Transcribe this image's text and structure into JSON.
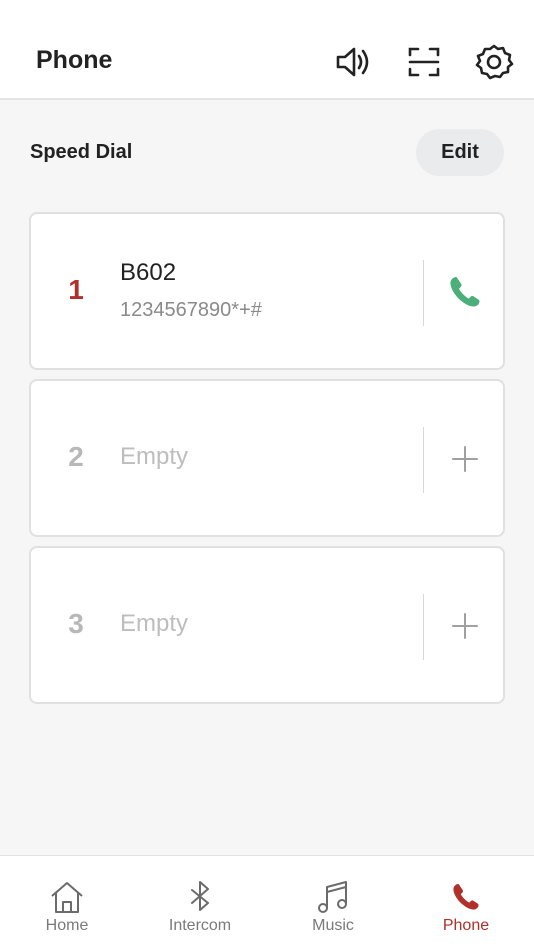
{
  "header": {
    "title": "Phone",
    "icons": [
      "speaker-icon",
      "scan-icon",
      "gear-icon"
    ]
  },
  "speed_dial": {
    "title": "Speed Dial",
    "edit_label": "Edit",
    "entries": [
      {
        "index": "1",
        "name": "B602",
        "number": "1234567890*+#",
        "action": "phone-icon"
      },
      {
        "index": "2",
        "placeholder": "Empty",
        "action": "plus-icon"
      },
      {
        "index": "3",
        "placeholder": "Empty",
        "action": "plus-icon"
      }
    ]
  },
  "tabbar": {
    "tabs": [
      {
        "label": "Home",
        "icon": "home-icon"
      },
      {
        "label": "Intercom",
        "icon": "bluetooth-icon"
      },
      {
        "label": "Music",
        "icon": "music-icon"
      },
      {
        "label": "Phone",
        "icon": "phone-icon",
        "active": true
      }
    ]
  },
  "colors": {
    "accent": "#b0302a",
    "call_green": "#4caf7a",
    "muted": "#bdbdbd"
  }
}
